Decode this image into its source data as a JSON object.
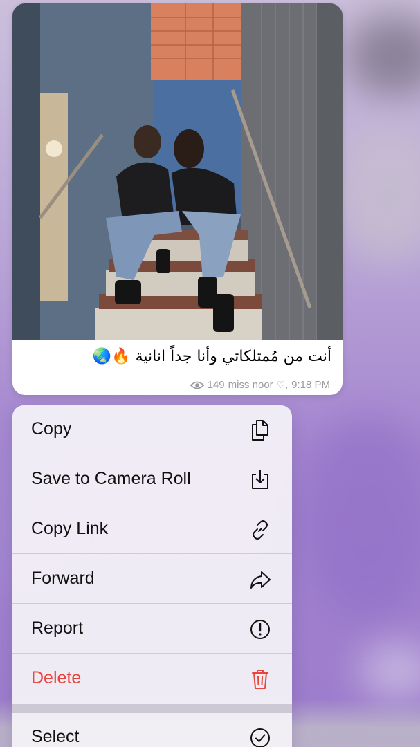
{
  "message": {
    "caption": "أنت من مُمتلكاتي وأنا جداً انانية 🔥🌏",
    "views": "149",
    "author": "miss noor",
    "heart": "♡,",
    "time": "9:18 PM"
  },
  "context_menu": {
    "items": [
      {
        "label": "Copy",
        "icon": "copy-icon"
      },
      {
        "label": "Save to Camera Roll",
        "icon": "save-download-icon"
      },
      {
        "label": "Copy Link",
        "icon": "link-icon"
      },
      {
        "label": "Forward",
        "icon": "forward-arrow-icon"
      },
      {
        "label": "Report",
        "icon": "exclamation-circle-icon"
      },
      {
        "label": "Delete",
        "icon": "trash-icon",
        "destructive": true
      },
      {
        "label": "Select",
        "icon": "checkmark-circle-icon"
      }
    ]
  },
  "colors": {
    "destructive": "#e8453c",
    "background_purple": "#a586d0"
  }
}
